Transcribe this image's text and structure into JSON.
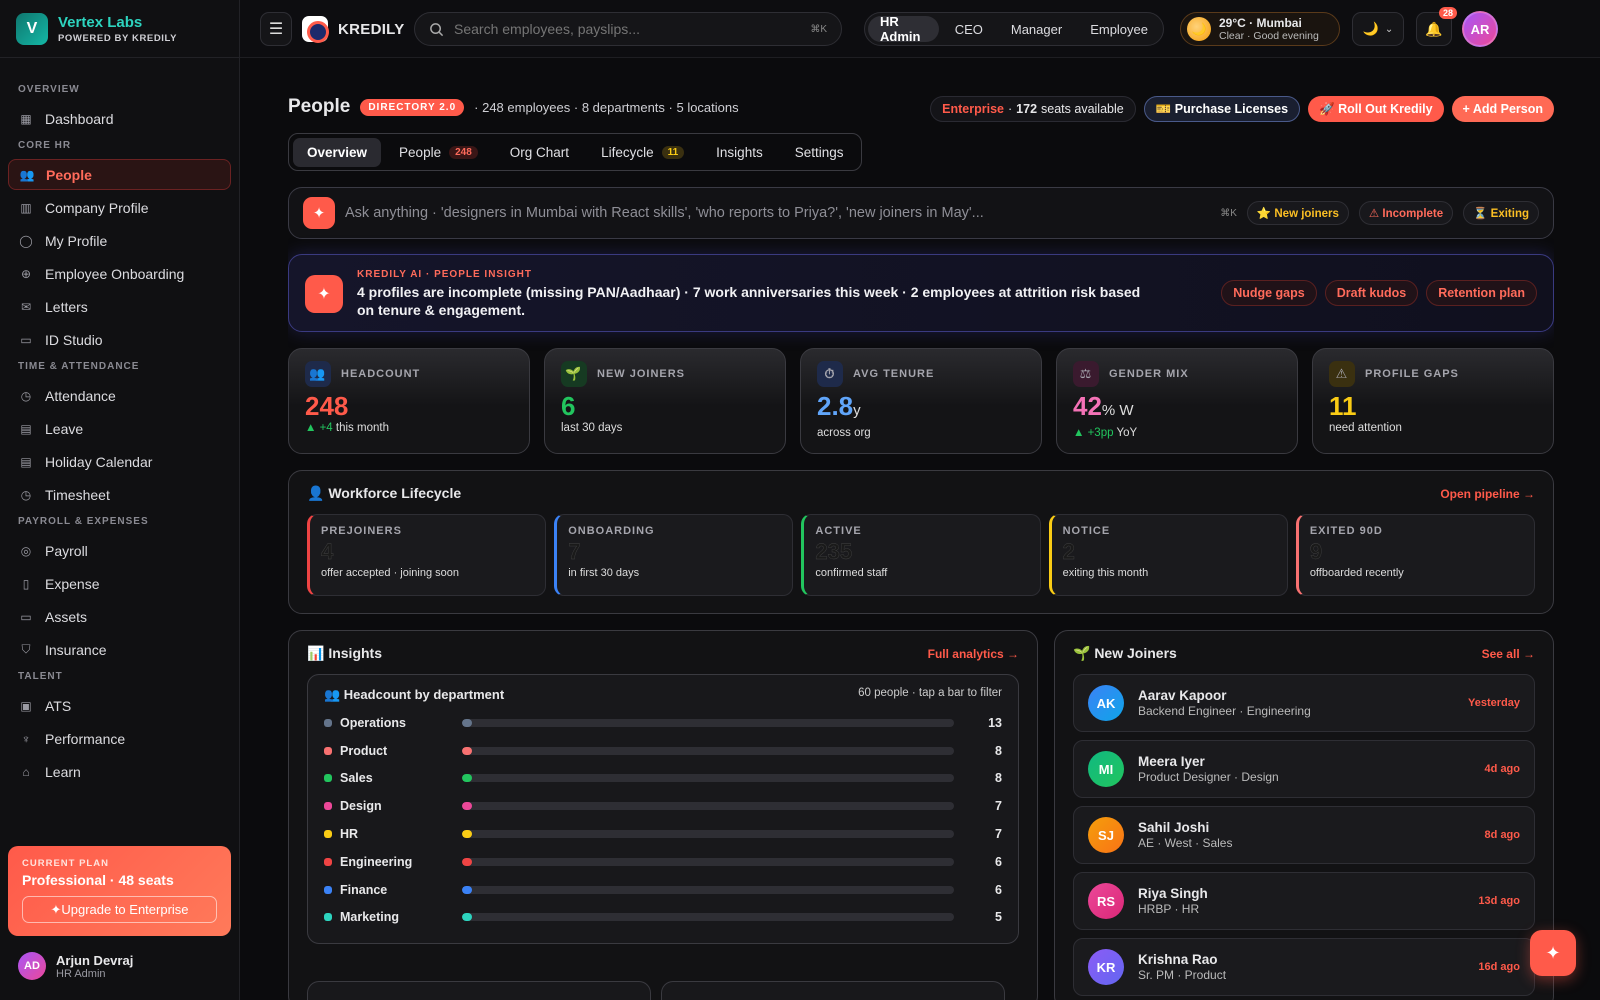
{
  "brand": {
    "name": "Vertex Labs",
    "sub": "POWERED BY KREDILY",
    "logo": "V"
  },
  "sidebar": {
    "sections": [
      {
        "label": "OVERVIEW",
        "items": [
          {
            "label": "Dashboard",
            "icon": "grid-icon"
          }
        ]
      },
      {
        "label": "CORE HR",
        "items": [
          {
            "label": "People",
            "icon": "users-icon",
            "active": true
          },
          {
            "label": "Company Profile",
            "icon": "building-icon"
          },
          {
            "label": "My Profile",
            "icon": "user-icon"
          },
          {
            "label": "Employee Onboarding",
            "icon": "user-plus-icon"
          },
          {
            "label": "Letters",
            "icon": "mail-icon"
          },
          {
            "label": "ID Studio",
            "icon": "id-card-icon"
          }
        ]
      },
      {
        "label": "TIME & ATTENDANCE",
        "items": [
          {
            "label": "Attendance",
            "icon": "clock-icon"
          },
          {
            "label": "Leave",
            "icon": "calendar-icon"
          },
          {
            "label": "Holiday Calendar",
            "icon": "calendar-icon"
          },
          {
            "label": "Timesheet",
            "icon": "clock-icon"
          }
        ]
      },
      {
        "label": "PAYROLL & EXPENSES",
        "items": [
          {
            "label": "Payroll",
            "icon": "coin-icon"
          },
          {
            "label": "Expense",
            "icon": "receipt-icon"
          },
          {
            "label": "Assets",
            "icon": "monitor-icon"
          },
          {
            "label": "Insurance",
            "icon": "shield-icon"
          }
        ]
      },
      {
        "label": "TALENT",
        "items": [
          {
            "label": "ATS",
            "icon": "clipboard-icon"
          },
          {
            "label": "Performance",
            "icon": "trophy-icon"
          },
          {
            "label": "Learn",
            "icon": "graduation-icon"
          }
        ]
      }
    ],
    "plan": {
      "label": "CURRENT PLAN",
      "title": "Professional · 48 seats",
      "upgrade": "✦Upgrade to Enterprise"
    },
    "user": {
      "initials": "AD",
      "name": "Arjun Devraj",
      "role": "HR Admin"
    }
  },
  "topbar": {
    "product": "KREDILY",
    "search_placeholder": "Search employees, payslips...",
    "search_kbd": "⌘K",
    "roles": [
      "HR Admin",
      "CEO",
      "Manager",
      "Employee"
    ],
    "weather": {
      "title": "29°C · Mumbai",
      "sub": "Clear · Good evening"
    },
    "notifications": "28",
    "avatar": "AR"
  },
  "page": {
    "title": "People",
    "badge": "DIRECTORY 2.0",
    "meta": "· 248 employees · 8 departments · 5 locations",
    "enterprise": {
      "label": "Enterprise",
      "seats": "172",
      "rest": "seats available"
    },
    "purchase": "🎫 Purchase Licenses",
    "rollout": "🚀 Roll Out Kredily",
    "add": "+ Add Person",
    "tabs": [
      {
        "label": "Overview",
        "active": true
      },
      {
        "label": "People",
        "count": "248"
      },
      {
        "label": "Org Chart"
      },
      {
        "label": "Lifecycle",
        "count": "11"
      },
      {
        "label": "Insights"
      },
      {
        "label": "Settings"
      }
    ]
  },
  "ask": {
    "placeholder": "Ask anything · 'designers in Mumbai with React skills', 'who reports to Priya?', 'new joiners in May'...",
    "kbd": "⌘K",
    "chips": [
      "⭐ New joiners",
      "⚠ Incomplete",
      "⏳ Exiting"
    ]
  },
  "ai": {
    "label": "KREDILY AI · PEOPLE INSIGHT",
    "text": "4 profiles are incomplete (missing PAN/Aadhaar) · 7 work anniversaries this week · 2 employees at attrition risk based on tenure & engagement.",
    "actions": [
      "Nudge gaps",
      "Draft kudos",
      "Retention plan"
    ]
  },
  "kpis": [
    {
      "label": "HEADCOUNT",
      "value": "248",
      "unit": "",
      "delta": "▲ +4",
      "sub": "this month",
      "color": "#ff5a4a",
      "icon": "👥",
      "iconbg": "#1e2a4a"
    },
    {
      "label": "NEW JOINERS",
      "value": "6",
      "unit": "",
      "delta": "",
      "sub": "last 30 days",
      "color": "#22c55e",
      "icon": "🌱",
      "iconbg": "#163a22"
    },
    {
      "label": "AVG TENURE",
      "value": "2.8",
      "unit": "y",
      "delta": "",
      "sub": "across org",
      "color": "#60a5fa",
      "icon": "⏱",
      "iconbg": "#1e2a4a"
    },
    {
      "label": "GENDER MIX",
      "value": "42",
      "unit": "% W",
      "delta": "▲ +3pp",
      "sub": "YoY",
      "color": "#f472b6",
      "icon": "⚖",
      "iconbg": "#3a1a2e"
    },
    {
      "label": "PROFILE GAPS",
      "value": "11",
      "unit": "",
      "delta": "",
      "sub": "need attention",
      "color": "#facc15",
      "icon": "⚠",
      "iconbg": "#3a3010"
    }
  ],
  "lifecycle": {
    "title": "👤 Workforce Lifecycle",
    "action": "Open pipeline →",
    "stages": [
      {
        "label": "PREJOINERS",
        "value": "4",
        "sub": "offer accepted · joining soon",
        "color": "#ef4444"
      },
      {
        "label": "ONBOARDING",
        "value": "7",
        "sub": "in first 30 days",
        "color": "#3b82f6"
      },
      {
        "label": "ACTIVE",
        "value": "235",
        "sub": "confirmed staff",
        "color": "#22c55e"
      },
      {
        "label": "NOTICE",
        "value": "2",
        "sub": "exiting this month",
        "color": "#facc15"
      },
      {
        "label": "EXITED 90D",
        "value": "9",
        "sub": "offboarded recently",
        "color": "#f87171"
      }
    ]
  },
  "insights": {
    "title": "📊 Insights",
    "action": "Full analytics →",
    "dept_title": "👥 Headcount by department",
    "dept_meta": "60 people · tap a bar to filter",
    "depts": [
      {
        "name": "Operations",
        "value": 13,
        "color": "#64748b",
        "fill": 0.02
      },
      {
        "name": "Product",
        "value": 8,
        "color": "#f87171",
        "fill": 0.02
      },
      {
        "name": "Sales",
        "value": 8,
        "color": "#22c55e",
        "fill": 0.02
      },
      {
        "name": "Design",
        "value": 7,
        "color": "#ec4899",
        "fill": 0.02
      },
      {
        "name": "HR",
        "value": 7,
        "color": "#facc15",
        "fill": 0.02
      },
      {
        "name": "Engineering",
        "value": 6,
        "color": "#ef4444",
        "fill": 0.02
      },
      {
        "name": "Finance",
        "value": 6,
        "color": "#3b82f6",
        "fill": 0.02
      },
      {
        "name": "Marketing",
        "value": 5,
        "color": "#2dd4bf",
        "fill": 0.02
      }
    ]
  },
  "joiners": {
    "title": "🌱 New Joiners",
    "action": "See all →",
    "list": [
      {
        "initials": "AK",
        "name": "Aarav Kapoor",
        "role": "Backend Engineer · Engineering",
        "when": "Yesterday",
        "bg": "linear-gradient(135deg,#3b82f6,#0ea5e9)"
      },
      {
        "initials": "MI",
        "name": "Meera Iyer",
        "role": "Product Designer · Design",
        "when": "4d ago",
        "bg": "linear-gradient(135deg,#10b981,#22c55e)"
      },
      {
        "initials": "SJ",
        "name": "Sahil Joshi",
        "role": "AE · West · Sales",
        "when": "8d ago",
        "bg": "linear-gradient(135deg,#f59e0b,#f97316)"
      },
      {
        "initials": "RS",
        "name": "Riya Singh",
        "role": "HRBP · HR",
        "when": "13d ago",
        "bg": "linear-gradient(135deg,#ec4899,#db2777)"
      },
      {
        "initials": "KR",
        "name": "Krishna Rao",
        "role": "Sr. PM · Product",
        "when": "16d ago",
        "bg": "linear-gradient(135deg,#8b5cf6,#6366f1)"
      }
    ]
  }
}
